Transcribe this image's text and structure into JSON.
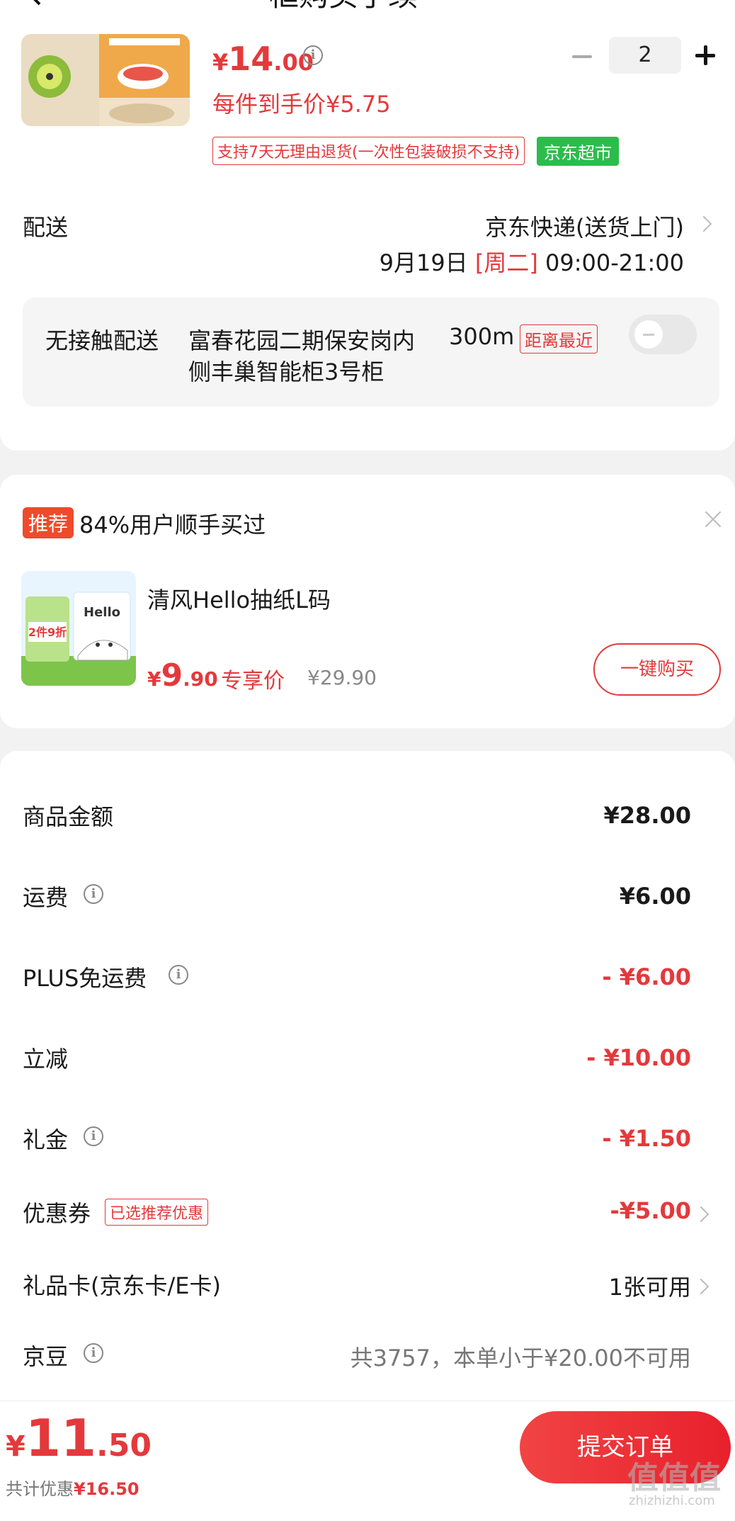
{
  "header": {
    "title_partial": "框购买手续"
  },
  "product": {
    "price_currency": "¥",
    "price_int": "14",
    "price_dec": ".00",
    "unit_price": "每件到手价¥5.75",
    "quantity": "2",
    "tag_return": "支持7天无理由退货(一次性包装破损不支持)",
    "tag_store": "京东超市"
  },
  "delivery": {
    "label": "配送",
    "method": "京东快递(送货上门)",
    "date": "9月19日 ",
    "weekday": "[周二]",
    "time": " 09:00-21:00",
    "contactless_label": "无接触配送",
    "addr_line1": "富春花园二期保安岗内",
    "addr_line2": "侧丰巢智能柜3号柜",
    "distance": "300m",
    "nearest_tag": "距离最近"
  },
  "recommend": {
    "badge": "推荐",
    "text": "84%用户顺手买过",
    "product_name": "清风Hello抽纸L码",
    "price_currency": "¥",
    "price_int": "9",
    "price_dec": ".90",
    "exclusive": "专享价",
    "original": "¥29.90",
    "buy_label": "一键购买",
    "img_text_hello": "Hello",
    "img_text_promo": "2件9折"
  },
  "summary": {
    "goods_label": "商品金额",
    "goods_value": "¥28.00",
    "freight_label": "运费",
    "freight_value": "¥6.00",
    "plus_label": "PLUS免运费",
    "plus_value": "- ¥6.00",
    "instant_label": "立减",
    "instant_value": "- ¥10.00",
    "gift_label": "礼金",
    "gift_value": "- ¥1.50",
    "coupon_label": "优惠券",
    "coupon_tag": "已选推荐优惠",
    "coupon_value": "-¥5.00",
    "card_label": "礼品卡(京东卡/E卡)",
    "card_value": "1张可用",
    "bean_label": "京豆",
    "bean_value": "共3757，本单小于¥20.00不可用"
  },
  "bottom": {
    "total_currency": "¥",
    "total_int": "11",
    "total_dec": ".50",
    "discount_label": "共计优惠",
    "discount_value": "¥16.50",
    "submit_label": "提交订单",
    "watermark": "值值值",
    "watermark_sub": "zhizhizhi.com"
  },
  "colors": {
    "accent": "#e4393c",
    "store_green": "#2bbd4c"
  }
}
